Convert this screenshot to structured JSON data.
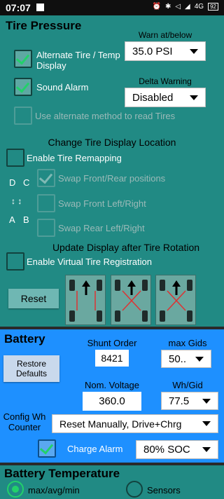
{
  "status_bar": {
    "time": "07:07",
    "right_icons": [
      "alarm-icon",
      "bluetooth-icon",
      "volume-icon",
      "signal-icon",
      "4g-icon",
      "battery-icon"
    ],
    "battery_text": "92"
  },
  "tire_pressure": {
    "title": "Tire Pressure",
    "warn_label": "Warn at/below",
    "warn_value": "35.0 PSI",
    "alternate_display_label": "Alternate Tire / Temp Display",
    "sound_alarm_label": "Sound Alarm",
    "delta_label": "Delta Warning",
    "delta_value": "Disabled",
    "alt_method_label": "Use alternate method to read Tires",
    "change_location_title": "Change Tire Display Location",
    "enable_remap_label": "Enable Tire Remapping",
    "pos_d": "D",
    "pos_c": "C",
    "pos_a": "A",
    "pos_b": "B",
    "arrows": "↕  ↕",
    "swap_front_rear": "Swap Front/Rear positions",
    "swap_front_lr": "Swap Front Left/Right",
    "swap_rear_lr": "Swap Rear Left/Right",
    "update_title": "Update Display after Tire Rotation",
    "virtual_reg_label": "Enable Virtual Tire Registration",
    "reset_label": "Reset"
  },
  "battery": {
    "title": "Battery",
    "shunt_label": "Shunt Order",
    "shunt_value": "8421",
    "max_gids_label": "max Gids",
    "max_gids_value": "50..",
    "restore_label": "Restore Defaults",
    "nom_voltage_label": "Nom. Voltage",
    "nom_voltage_value": "360.0",
    "wh_gid_label": "Wh/Gid",
    "wh_gid_value": "77.5",
    "config_label": "Config Wh Counter",
    "config_value": "Reset Manually, Drive+Chrg",
    "charge_alarm_label": "Charge Alarm",
    "charge_alarm_value": "80% SOC"
  },
  "battery_temp": {
    "title": "Battery Temperature",
    "radio1_label": "max/avg/min",
    "radio2_label": "Sensors"
  },
  "colors": {
    "teal": "#218a84",
    "blue": "#1e90ff",
    "check_green": "#22d16a"
  }
}
